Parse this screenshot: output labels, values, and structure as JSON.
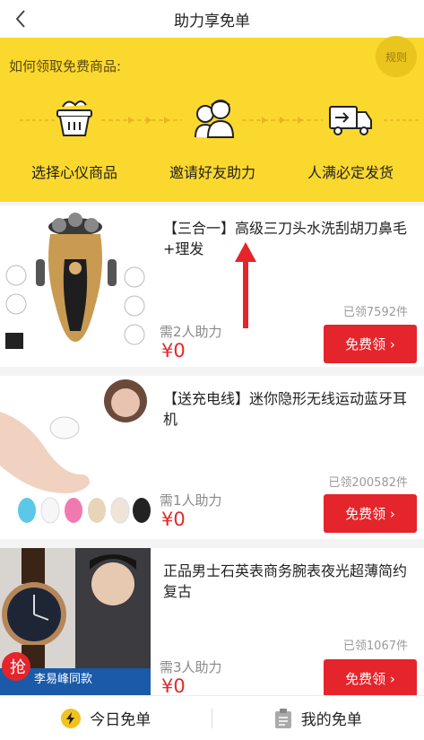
{
  "header": {
    "title": "助力享免单"
  },
  "banner": {
    "how_text": "如何领取免费商品:",
    "rules_label": "规则",
    "steps": [
      {
        "label": "选择心仪商品",
        "icon": "basket-icon"
      },
      {
        "label": "邀请好友助力",
        "icon": "friends-icon"
      },
      {
        "label": "人满必定发货",
        "icon": "truck-icon"
      }
    ]
  },
  "products": [
    {
      "name": "【三合一】高级三刀头水洗刮胡刀鼻毛+理发",
      "claimed": "已领7592件",
      "need": "需2人助力",
      "price": "¥0",
      "button": "免费领 ›"
    },
    {
      "name": "【送充电线】迷你隐形无线运动蓝牙耳机",
      "claimed": "已领200582件",
      "need": "需1人助力",
      "price": "¥0",
      "button": "免费领 ›"
    },
    {
      "name": "正品男士石英表商务腕表夜光超薄简约复古",
      "claimed": "已领1067件",
      "need": "需3人助力",
      "price": "¥0",
      "button": "免费领 ›",
      "badge": "抢",
      "badge_sub": "李易峰同款"
    }
  ],
  "tabs": [
    {
      "label": "今日免单",
      "icon": "lightning-icon"
    },
    {
      "label": "我的免单",
      "icon": "clipboard-icon"
    }
  ],
  "colors": {
    "accent": "#e4252b",
    "banner": "#fbd82d"
  }
}
